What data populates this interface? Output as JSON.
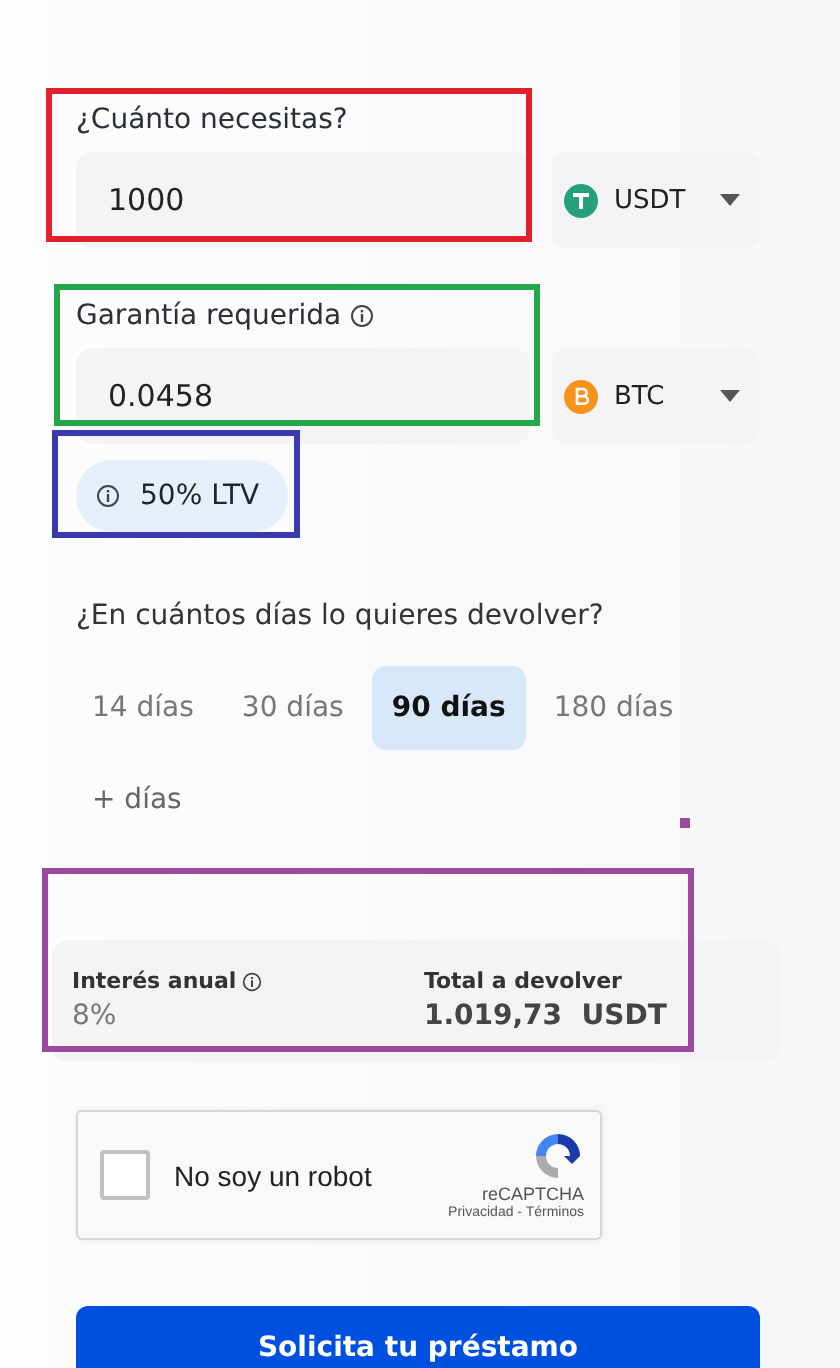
{
  "amount": {
    "label": "¿Cuánto necesitas?",
    "value": "1000",
    "currency": {
      "kind": "usdt",
      "label": "USDT"
    }
  },
  "collateral": {
    "label": "Garantía requerida",
    "value": "0.0458",
    "currency": {
      "kind": "btc",
      "label": "BTC"
    }
  },
  "ltv": {
    "label": "50% LTV"
  },
  "term": {
    "question": "¿En cuántos días lo quieres devolver?",
    "options": [
      {
        "label": "14 días",
        "selected": false
      },
      {
        "label": "30 días",
        "selected": false
      },
      {
        "label": "90 días",
        "selected": true
      },
      {
        "label": "180 días",
        "selected": false
      }
    ],
    "more": "+ días"
  },
  "summary": {
    "interest_label": "Interés anual",
    "interest_value": "8%",
    "total_label": "Total a devolver",
    "total_value": "1.019,73",
    "total_currency": "USDT"
  },
  "captcha": {
    "label": "No soy un robot",
    "checked": false,
    "brand": "reCAPTCHA",
    "links": "Privacidad - Términos"
  },
  "submit": "Solicita tu préstamo"
}
